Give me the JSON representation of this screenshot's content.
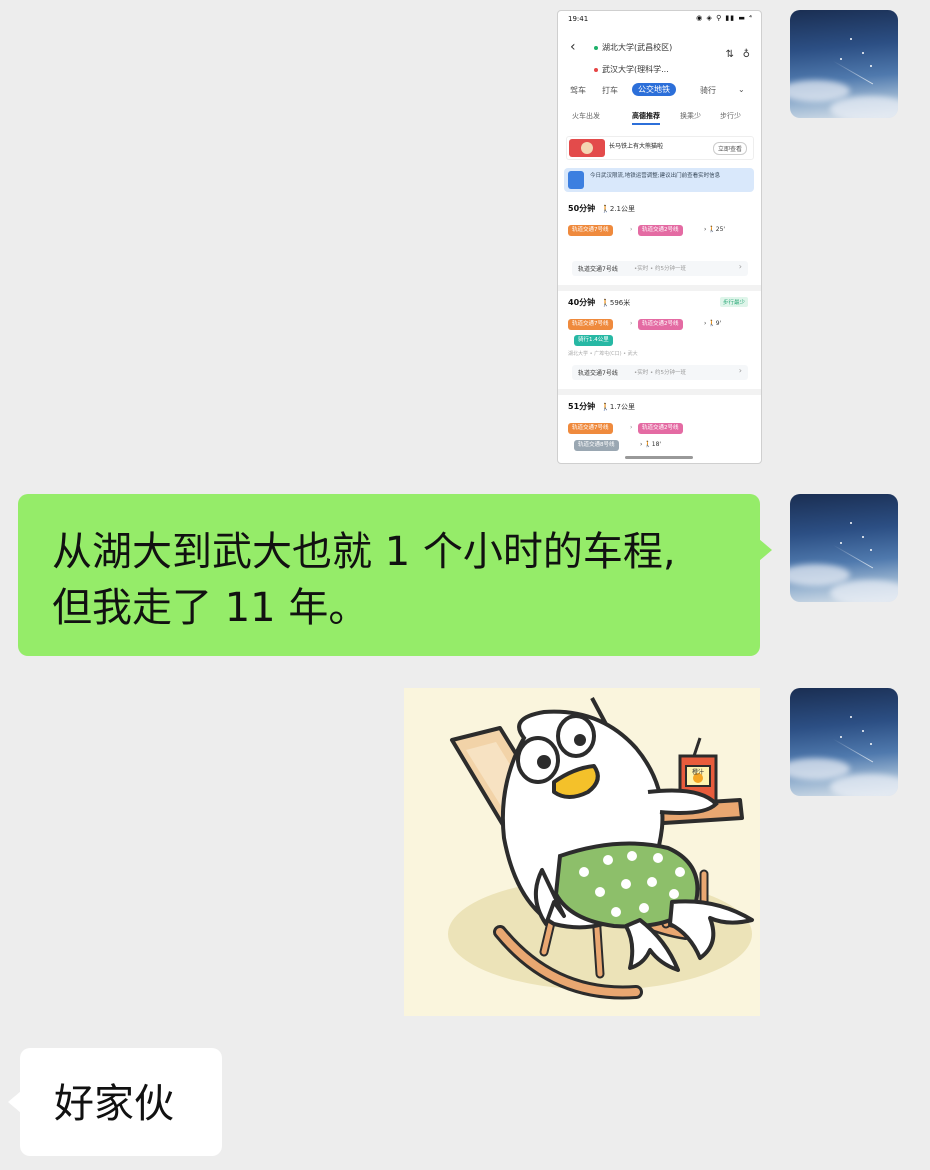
{
  "messages": [
    {
      "type": "image",
      "screenshot": {
        "status_time": "19:41",
        "status_icons": "◉ ◈ ⚲ ▮▮ ▬ ⁴",
        "from": "湖北大学(武昌校区)",
        "to": "武汉大学(理科学...",
        "modes": [
          "驾车",
          "打车",
          "公交地铁",
          "骑行"
        ],
        "active_mode": "公交地铁",
        "subtabs": [
          "火车出发",
          "高德推荐",
          "换乘少",
          "步行少"
        ],
        "active_subtab": "高德推荐",
        "ad_text": "长马铁上有大熊猫啦",
        "ad_button": "立即查看",
        "notice_text": "今日武汉限流,地铁运营调整;建议出门前查看实时信息",
        "routes": [
          {
            "time": "50分钟",
            "walk": "2.1公里",
            "tag": "",
            "chips": [
              "轨道交通7号线",
              "轨道交通2号线"
            ],
            "walk_min": "25'",
            "detail": "",
            "bar_title": "轨道交通7号线",
            "bar_sub": "•实时 • 约5分钟一班"
          },
          {
            "time": "40分钟",
            "walk": "596米",
            "tag": "步行最少",
            "chips": [
              "轨道交通7号线",
              "轨道交通2号线",
              "骑行1.4公里"
            ],
            "walk_min": "9'",
            "detail": "湖北大学 • 广埠屯(C口) • 武大",
            "bar_title": "轨道交通7号线",
            "bar_sub": "•实时 • 约5分钟一班"
          },
          {
            "time": "51分钟",
            "walk": "1.7公里",
            "tag": "",
            "chips": [
              "轨道交通7号线",
              "轨道交通2号线",
              "轨道交通8号线"
            ],
            "walk_min": "18'",
            "detail": "",
            "bar_title": "",
            "bar_sub": ""
          }
        ]
      }
    },
    {
      "type": "text",
      "lines": [
        "从湖大到武大也就 1 个小时的车程,",
        "但我走了 11 年。"
      ]
    },
    {
      "type": "sticker",
      "label": "鸭子躺椅表情",
      "juice_label": "橙汁"
    },
    {
      "type": "text",
      "text": "好家伙"
    }
  ],
  "colors": {
    "background": "#ededed",
    "sent_bubble": "#95ec69",
    "received_bubble": "#ffffff"
  }
}
